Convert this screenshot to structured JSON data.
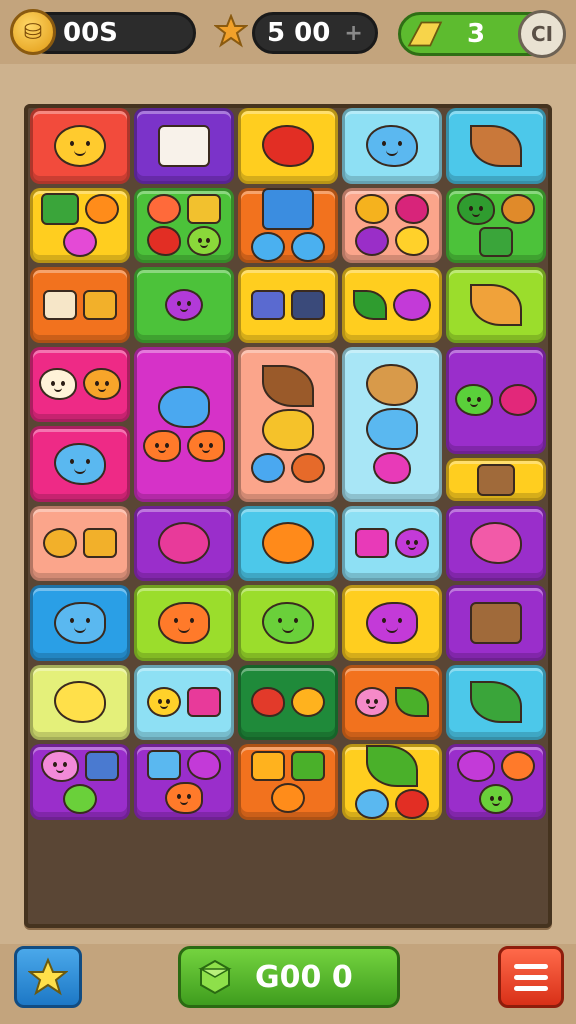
{
  "hud": {
    "coins_value": "00S",
    "score_value": "5 00",
    "score_plus": "+",
    "lives_value": "3",
    "pause_label": "CI"
  },
  "bottom": {
    "go_label": "G00  0"
  },
  "colors": {
    "red": "#f24b3c",
    "purple": "#7b33c9",
    "yellow": "#ffce1f",
    "sky": "#8ee0f4",
    "cyan": "#4cc8ea",
    "lime": "#9bdd2c",
    "green": "#4cc23a",
    "orange": "#f2721e",
    "peach": "#fba58b",
    "pink": "#ee2a86",
    "magenta": "#d632c8",
    "violet": "#9a2ecb",
    "blue": "#2a9fe6",
    "paleyellow": "#e4f07a",
    "darkgreen": "#1f8a3a",
    "lightcyan": "#a8e6f6"
  },
  "tiles": [
    {
      "row": 0,
      "col": 0,
      "rows": 1,
      "color": "red",
      "icons": [
        {
          "name": "smiley-face-icon",
          "shape": "round",
          "size": "big",
          "fill": "#ffcb2e",
          "face": true
        }
      ]
    },
    {
      "row": 0,
      "col": 1,
      "rows": 1,
      "color": "purple",
      "icons": [
        {
          "name": "book-pages-icon",
          "shape": "rect",
          "size": "big",
          "fill": "#f8f2ea"
        }
      ]
    },
    {
      "row": 0,
      "col": 2,
      "rows": 1,
      "color": "yellow",
      "icons": [
        {
          "name": "strawberry-icon",
          "shape": "blob",
          "size": "big",
          "fill": "#e22e24"
        }
      ]
    },
    {
      "row": 0,
      "col": 3,
      "rows": 1,
      "color": "sky",
      "icons": [
        {
          "name": "blue-creature-icon",
          "shape": "blob",
          "size": "big",
          "fill": "#5bb8f0",
          "face": true
        }
      ]
    },
    {
      "row": 0,
      "col": 4,
      "rows": 1,
      "color": "cyan",
      "icons": [
        {
          "name": "bread-loaf-icon",
          "shape": "leaf",
          "size": "big",
          "fill": "#c9783a"
        }
      ]
    },
    {
      "row": 1,
      "col": 0,
      "rows": 1,
      "color": "yellow",
      "icons": [
        {
          "name": "green-folder-icon",
          "shape": "rect",
          "size": "med",
          "fill": "#3aa53a"
        },
        {
          "name": "orange-flower-icon",
          "shape": "round",
          "size": "sm",
          "fill": "#ff8c1a"
        },
        {
          "name": "pink-flower-icon",
          "shape": "round",
          "size": "sm",
          "fill": "#e44ad6"
        }
      ]
    },
    {
      "row": 1,
      "col": 1,
      "rows": 1,
      "color": "green",
      "icons": [
        {
          "name": "magnifier-icon",
          "shape": "round",
          "size": "sm",
          "fill": "#ff6a3a"
        },
        {
          "name": "diamond-sign-icon",
          "shape": "rect",
          "size": "sm",
          "fill": "#f2c12e"
        },
        {
          "name": "strawberry-icon",
          "shape": "blob",
          "size": "sm",
          "fill": "#e22e24"
        },
        {
          "name": "green-apple-icon",
          "shape": "round",
          "size": "sm",
          "fill": "#8ad83a",
          "face": true
        }
      ]
    },
    {
      "row": 1,
      "col": 2,
      "rows": 1,
      "color": "orange",
      "icons": [
        {
          "name": "open-book-icon",
          "shape": "rect",
          "size": "big",
          "fill": "#3b8de0"
        },
        {
          "name": "blue-ornament-icon",
          "shape": "round",
          "size": "sm",
          "fill": "#4ab0f0"
        },
        {
          "name": "blue-clover-icon",
          "shape": "round",
          "size": "sm",
          "fill": "#4ab0f0"
        }
      ]
    },
    {
      "row": 1,
      "col": 3,
      "rows": 1,
      "color": "peach",
      "icons": [
        {
          "name": "pineapple-icon",
          "shape": "blob",
          "size": "sm",
          "fill": "#f5b21e"
        },
        {
          "name": "raspberry-icon",
          "shape": "blob",
          "size": "sm",
          "fill": "#d8247a"
        },
        {
          "name": "plum-icon",
          "shape": "round",
          "size": "sm",
          "fill": "#9a2ec8"
        },
        {
          "name": "lemon-icon",
          "shape": "blob",
          "size": "sm",
          "fill": "#ffd12a"
        }
      ]
    },
    {
      "row": 1,
      "col": 4,
      "rows": 1,
      "color": "green",
      "icons": [
        {
          "name": "broccoli-icon",
          "shape": "blob",
          "size": "med",
          "fill": "#2f9c2f",
          "face": true
        },
        {
          "name": "cupcake-icon",
          "shape": "round",
          "size": "sm",
          "fill": "#e08a2a"
        },
        {
          "name": "green-grid-box-icon",
          "shape": "rect",
          "size": "sm",
          "fill": "#3aa53a"
        }
      ]
    },
    {
      "row": 2,
      "col": 0,
      "rows": 1,
      "color": "orange",
      "icons": [
        {
          "name": "tag-label-icon",
          "shape": "rect",
          "size": "sm",
          "fill": "#f6e6c8"
        },
        {
          "name": "jar-icon",
          "shape": "rect",
          "size": "sm",
          "fill": "#f2b02a"
        }
      ]
    },
    {
      "row": 2,
      "col": 1,
      "rows": 1,
      "color": "green",
      "icons": [
        {
          "name": "purple-dumbbell-icon",
          "shape": "round",
          "size": "med",
          "fill": "#b23ad8",
          "face": true
        }
      ]
    },
    {
      "row": 2,
      "col": 2,
      "rows": 1,
      "color": "yellow",
      "icons": [
        {
          "name": "calculator-icon",
          "shape": "rect",
          "size": "sm",
          "fill": "#5a6ad0"
        },
        {
          "name": "phone-device-icon",
          "shape": "rect",
          "size": "sm",
          "fill": "#3a4a7a"
        }
      ]
    },
    {
      "row": 2,
      "col": 3,
      "rows": 1,
      "color": "yellow",
      "icons": [
        {
          "name": "leaf-icon",
          "shape": "leaf",
          "size": "sm",
          "fill": "#2f9c2f"
        },
        {
          "name": "lollipop-icon",
          "shape": "round",
          "size": "med",
          "fill": "#c33ad8"
        }
      ]
    },
    {
      "row": 2,
      "col": 4,
      "rows": 1,
      "color": "lime",
      "icons": [
        {
          "name": "cheese-wedge-icon",
          "shape": "leaf",
          "size": "big",
          "fill": "#f0a23a"
        }
      ]
    },
    {
      "row": 3,
      "col": 0,
      "rows": 1,
      "color": "pink",
      "icons": [
        {
          "name": "cream-cloud-icon",
          "shape": "blob",
          "size": "med",
          "fill": "#fff2d8",
          "face": true
        },
        {
          "name": "orange-candy-icon",
          "shape": "blob",
          "size": "med",
          "fill": "#f7a52a",
          "face": true
        }
      ]
    },
    {
      "row": 3,
      "col": 1,
      "rows": 2,
      "color": "magenta",
      "icons": [
        {
          "name": "blue-fish-icon",
          "shape": "fish",
          "size": "big",
          "fill": "#4aa8f0"
        },
        {
          "name": "orange-fish-icon",
          "shape": "fish",
          "size": "med",
          "fill": "#ff7a2a",
          "face": true
        },
        {
          "name": "orange-fish-icon",
          "shape": "fish",
          "size": "med",
          "fill": "#ff7a2a",
          "face": true
        }
      ]
    },
    {
      "row": 3,
      "col": 2,
      "rows": 2,
      "color": "peach",
      "icons": [
        {
          "name": "brown-seed-icon",
          "shape": "leaf",
          "size": "big",
          "fill": "#9a5a2a"
        },
        {
          "name": "yellow-fish-icon",
          "shape": "fish",
          "size": "big",
          "fill": "#f5c22a"
        },
        {
          "name": "blue-berry-icon",
          "shape": "round",
          "size": "sm",
          "fill": "#4aa8f0"
        },
        {
          "name": "orange-shell-icon",
          "shape": "round",
          "size": "sm",
          "fill": "#e66a2a"
        }
      ]
    },
    {
      "row": 3,
      "col": 3,
      "rows": 2,
      "color": "lightcyan",
      "icons": [
        {
          "name": "cookie-icon",
          "shape": "blob",
          "size": "big",
          "fill": "#d89a4a"
        },
        {
          "name": "blue-fish-icon",
          "shape": "fish",
          "size": "big",
          "fill": "#5ab8f0"
        },
        {
          "name": "pink-onion-icon",
          "shape": "blob",
          "size": "med",
          "fill": "#e83ab8"
        }
      ]
    },
    {
      "row": 3,
      "col": 4,
      "rows": 1.4,
      "color": "violet",
      "icons": [
        {
          "name": "green-blob-icon",
          "shape": "blob",
          "size": "med",
          "fill": "#5ad03a",
          "face": true
        },
        {
          "name": "rose-icon",
          "shape": "round",
          "size": "med",
          "fill": "#e2287a"
        }
      ]
    },
    {
      "row": 4,
      "col": 0,
      "rows": 1,
      "color": "pink",
      "icons": [
        {
          "name": "blue-cat-icon",
          "shape": "blob",
          "size": "big",
          "fill": "#5ab8f0",
          "face": true
        }
      ]
    },
    {
      "row": 4.4,
      "col": 4,
      "rows": 0.6,
      "color": "yellow",
      "icons": [
        {
          "name": "retro-tv-icon",
          "shape": "rect",
          "size": "med",
          "fill": "#a06a3a"
        }
      ]
    },
    {
      "row": 5,
      "col": 0,
      "rows": 1,
      "color": "peach",
      "icons": [
        {
          "name": "cookie-icon",
          "shape": "round",
          "size": "sm",
          "fill": "#f2b02a"
        },
        {
          "name": "jar-icon",
          "shape": "rect",
          "size": "sm",
          "fill": "#f2b02a"
        }
      ]
    },
    {
      "row": 5,
      "col": 1,
      "rows": 1,
      "color": "violet",
      "icons": [
        {
          "name": "pink-fruit-icon",
          "shape": "round",
          "size": "big",
          "fill": "#e83a9a"
        }
      ]
    },
    {
      "row": 5,
      "col": 2,
      "rows": 1,
      "color": "cyan",
      "icons": [
        {
          "name": "sunflower-icon",
          "shape": "round",
          "size": "big",
          "fill": "#ff8a1a"
        }
      ]
    },
    {
      "row": 5,
      "col": 3,
      "rows": 1,
      "color": "sky",
      "icons": [
        {
          "name": "pink-card-icon",
          "shape": "rect",
          "size": "sm",
          "fill": "#e83ab8"
        },
        {
          "name": "purple-plum-icon",
          "shape": "round",
          "size": "sm",
          "fill": "#c33ad8",
          "face": true
        }
      ]
    },
    {
      "row": 5,
      "col": 4,
      "rows": 1,
      "color": "violet",
      "icons": [
        {
          "name": "pink-heart-icon",
          "shape": "blob",
          "size": "big",
          "fill": "#f25aa8"
        }
      ]
    },
    {
      "row": 6,
      "col": 0,
      "rows": 1,
      "color": "blue",
      "icons": [
        {
          "name": "blue-fish-icon",
          "shape": "fish",
          "size": "big",
          "fill": "#5ab8f0",
          "face": true
        }
      ]
    },
    {
      "row": 6,
      "col": 1,
      "rows": 1,
      "color": "lime",
      "icons": [
        {
          "name": "orange-fish-icon",
          "shape": "fish",
          "size": "big",
          "fill": "#ff7a2a",
          "face": true
        }
      ]
    },
    {
      "row": 6,
      "col": 2,
      "rows": 1,
      "color": "lime",
      "icons": [
        {
          "name": "green-frog-icon",
          "shape": "blob",
          "size": "big",
          "fill": "#6ad03a",
          "face": true
        }
      ]
    },
    {
      "row": 6,
      "col": 3,
      "rows": 1,
      "color": "yellow",
      "icons": [
        {
          "name": "purple-fish-icon",
          "shape": "fish",
          "size": "big",
          "fill": "#c33ad8",
          "face": true
        }
      ]
    },
    {
      "row": 6,
      "col": 4,
      "rows": 1,
      "color": "violet",
      "icons": [
        {
          "name": "retro-tv-icon",
          "shape": "rect",
          "size": "big",
          "fill": "#a06a3a"
        }
      ]
    },
    {
      "row": 7,
      "col": 0,
      "rows": 1,
      "color": "paleyellow",
      "icons": [
        {
          "name": "yellow-candy-icon",
          "shape": "blob",
          "size": "big",
          "fill": "#ffe04a"
        }
      ]
    },
    {
      "row": 7,
      "col": 1,
      "rows": 1,
      "color": "sky",
      "icons": [
        {
          "name": "yellow-chick-icon",
          "shape": "round",
          "size": "sm",
          "fill": "#ffd12a",
          "face": true
        },
        {
          "name": "pink-jar-icon",
          "shape": "rect",
          "size": "sm",
          "fill": "#e83a9a"
        }
      ]
    },
    {
      "row": 7,
      "col": 2,
      "rows": 1,
      "color": "darkgreen",
      "icons": [
        {
          "name": "red-pepper-icon",
          "shape": "blob",
          "size": "sm",
          "fill": "#e23a2a"
        },
        {
          "name": "yellow-orange-icon",
          "shape": "round",
          "size": "sm",
          "fill": "#ffb21e"
        }
      ]
    },
    {
      "row": 7,
      "col": 3,
      "rows": 1,
      "color": "orange",
      "icons": [
        {
          "name": "pink-peach-icon",
          "shape": "round",
          "size": "sm",
          "fill": "#f58ac8",
          "face": true
        },
        {
          "name": "green-leaf-icon",
          "shape": "leaf",
          "size": "sm",
          "fill": "#4ab02a"
        }
      ]
    },
    {
      "row": 7,
      "col": 4,
      "rows": 1,
      "color": "cyan",
      "icons": [
        {
          "name": "green-leaf-icon",
          "shape": "leaf",
          "size": "big",
          "fill": "#3aa53a"
        }
      ]
    },
    {
      "row": 8,
      "col": 0,
      "rows": 1,
      "color": "violet",
      "icons": [
        {
          "name": "pink-mouse-icon",
          "shape": "blob",
          "size": "med",
          "fill": "#f28ad8",
          "face": true
        },
        {
          "name": "bottle-icon",
          "shape": "rect",
          "size": "sm",
          "fill": "#4a7ad0"
        },
        {
          "name": "melon-icon",
          "shape": "round",
          "size": "sm",
          "fill": "#6ad03a"
        }
      ]
    },
    {
      "row": 8,
      "col": 1,
      "rows": 1,
      "color": "violet",
      "icons": [
        {
          "name": "blue-bottle-icon",
          "shape": "rect",
          "size": "sm",
          "fill": "#5ab8f0"
        },
        {
          "name": "purple-gem-icon",
          "shape": "blob",
          "size": "sm",
          "fill": "#c33ad8"
        },
        {
          "name": "orange-fish-icon",
          "shape": "fish",
          "size": "med",
          "fill": "#ff7a2a",
          "face": true
        }
      ]
    },
    {
      "row": 8,
      "col": 2,
      "rows": 1,
      "color": "orange",
      "icons": [
        {
          "name": "orange-card-icon",
          "shape": "rect",
          "size": "sm",
          "fill": "#ffb21e"
        },
        {
          "name": "green-card-icon",
          "shape": "rect",
          "size": "sm",
          "fill": "#4ab02a"
        },
        {
          "name": "orange-flower-icon",
          "shape": "round",
          "size": "sm",
          "fill": "#ff8c1a"
        }
      ]
    },
    {
      "row": 8,
      "col": 3,
      "rows": 1,
      "color": "yellow",
      "icons": [
        {
          "name": "pea-pod-icon",
          "shape": "leaf",
          "size": "big",
          "fill": "#4ab02a"
        },
        {
          "name": "blue-balloon-icon",
          "shape": "round",
          "size": "sm",
          "fill": "#5ab8f0"
        },
        {
          "name": "tomato-icon",
          "shape": "round",
          "size": "sm",
          "fill": "#e22e24"
        }
      ]
    },
    {
      "row": 8,
      "col": 4,
      "rows": 1,
      "color": "violet",
      "icons": [
        {
          "name": "purple-radish-icon",
          "shape": "blob",
          "size": "med",
          "fill": "#c33ad8"
        },
        {
          "name": "orange-ball-icon",
          "shape": "round",
          "size": "sm",
          "fill": "#ff7a2a"
        },
        {
          "name": "green-pea-icon",
          "shape": "round",
          "size": "sm",
          "fill": "#6ad03a",
          "face": true
        }
      ]
    }
  ]
}
